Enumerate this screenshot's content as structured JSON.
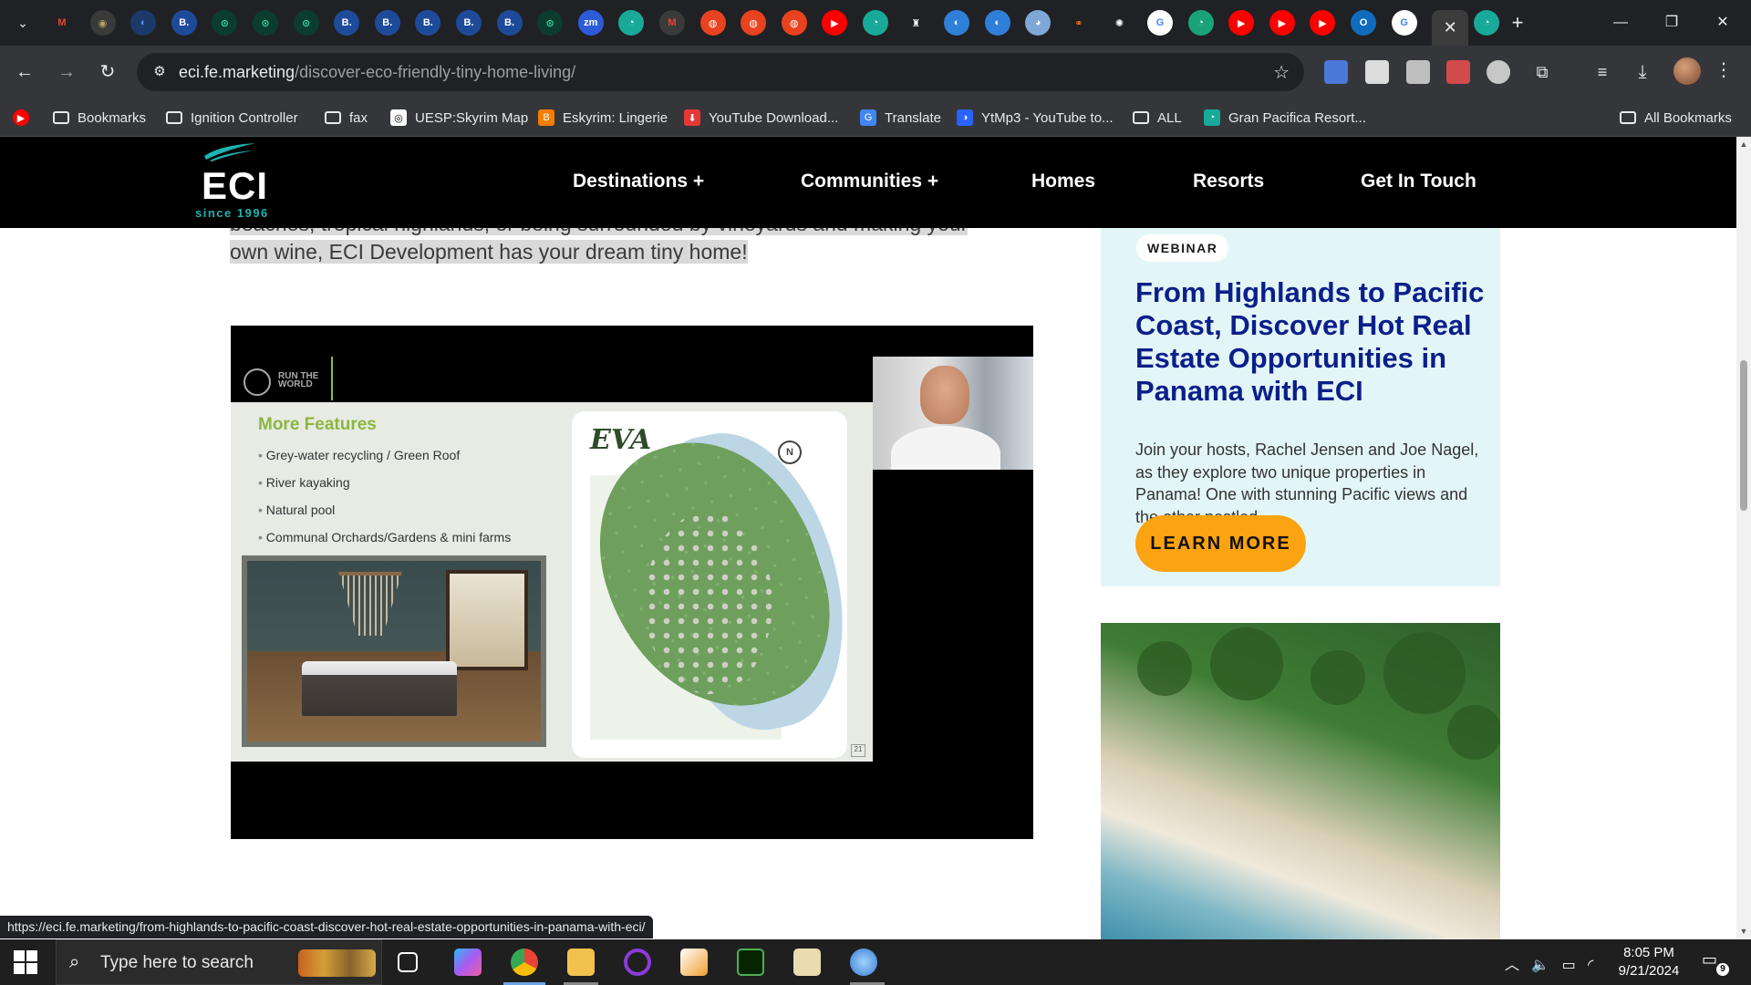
{
  "browser": {
    "tab_favicons": [
      {
        "name": "gmail-icon",
        "glyph": "M",
        "color": "#ea4335",
        "bg": "transparent"
      },
      {
        "name": "shield-seal-icon",
        "glyph": "◉",
        "color": "#b8a36a",
        "bg": "#3a3a3a"
      },
      {
        "name": "globe-tab-icon",
        "glyph": "◐",
        "color": "#4f9bff",
        "bg": "#1b3a6a"
      },
      {
        "name": "booking-icon",
        "glyph": "B.",
        "color": "#ffffff",
        "bg": "#1e4a9a"
      },
      {
        "name": "tripadvisor-icon",
        "glyph": "⊙",
        "color": "#34e0a1",
        "bg": "#0b3d2e"
      },
      {
        "name": "tripadvisor-icon",
        "glyph": "⊙",
        "color": "#34e0a1",
        "bg": "#0b3d2e"
      },
      {
        "name": "tripadvisor-icon",
        "glyph": "⊙",
        "color": "#34e0a1",
        "bg": "#0b3d2e"
      },
      {
        "name": "booking-icon",
        "glyph": "B.",
        "color": "#ffffff",
        "bg": "#1e4a9a"
      },
      {
        "name": "booking-icon",
        "glyph": "B.",
        "color": "#ffffff",
        "bg": "#1e4a9a"
      },
      {
        "name": "booking-icon",
        "glyph": "B.",
        "color": "#ffffff",
        "bg": "#1e4a9a"
      },
      {
        "name": "booking-icon",
        "glyph": "B.",
        "color": "#ffffff",
        "bg": "#1e4a9a"
      },
      {
        "name": "booking-icon",
        "glyph": "B.",
        "color": "#ffffff",
        "bg": "#1e4a9a"
      },
      {
        "name": "tripadvisor-icon",
        "glyph": "⊙",
        "color": "#34e0a1",
        "bg": "#0b3d2e"
      },
      {
        "name": "zoom-icon",
        "glyph": "zm",
        "color": "#ffffff",
        "bg": "#2d5bd8"
      },
      {
        "name": "teal-tab-icon",
        "glyph": "◔",
        "color": "#ffffff",
        "bg": "#18a999"
      },
      {
        "name": "gmail-icon",
        "glyph": "M",
        "color": "#ea4335",
        "bg": "#3a3a3a"
      },
      {
        "name": "red-app-icon",
        "glyph": "◍",
        "color": "#ffffff",
        "bg": "#e8421e"
      },
      {
        "name": "red-app-icon",
        "glyph": "◍",
        "color": "#ffffff",
        "bg": "#e8421e"
      },
      {
        "name": "red-app-icon",
        "glyph": "◍",
        "color": "#ffffff",
        "bg": "#e8421e"
      },
      {
        "name": "youtube-icon",
        "glyph": "▶",
        "color": "#ffffff",
        "bg": "#ff0000"
      },
      {
        "name": "teal-tab-icon",
        "glyph": "◔",
        "color": "#ffffff",
        "bg": "#18a999"
      },
      {
        "name": "castle-icon",
        "glyph": "♜",
        "color": "#ffffff",
        "bg": "#202124"
      },
      {
        "name": "globe-tab-icon",
        "glyph": "◐",
        "color": "#ffffff",
        "bg": "#2f7fd8"
      },
      {
        "name": "globe-tab-icon",
        "glyph": "◐",
        "color": "#ffffff",
        "bg": "#2f7fd8"
      },
      {
        "name": "chat-bubble-icon",
        "glyph": "◕",
        "color": "#ffffff",
        "bg": "#7fa8d8"
      },
      {
        "name": "link-icon",
        "glyph": "⚭",
        "color": "#ff7a1a",
        "bg": "transparent"
      },
      {
        "name": "openai-icon",
        "glyph": "✺",
        "color": "#ffffff",
        "bg": "#202124"
      },
      {
        "name": "google-icon",
        "glyph": "G",
        "color": "#4285f4",
        "bg": "#ffffff"
      },
      {
        "name": "green-chat-icon",
        "glyph": "◔",
        "color": "#ffffff",
        "bg": "#1aa37a"
      },
      {
        "name": "youtube-icon",
        "glyph": "▶",
        "color": "#ffffff",
        "bg": "#ff0000"
      },
      {
        "name": "youtube-icon",
        "glyph": "▶",
        "color": "#ffffff",
        "bg": "#ff0000"
      },
      {
        "name": "youtube-icon",
        "glyph": "▶",
        "color": "#ffffff",
        "bg": "#ff0000"
      },
      {
        "name": "outlook-icon",
        "glyph": "O",
        "color": "#ffffff",
        "bg": "#0f6cbd"
      },
      {
        "name": "google-icon",
        "glyph": "G",
        "color": "#4285f4",
        "bg": "#ffffff"
      }
    ],
    "last_tab_icon": {
      "name": "teal-tab-icon",
      "glyph": "◔",
      "color": "#ffffff",
      "bg": "#18a999"
    },
    "url_host": "eci.fe.marketing",
    "url_path": "/discover-eco-friendly-tiny-home-living/",
    "bookmarks": [
      {
        "label": "Bookmarks",
        "type": "folder"
      },
      {
        "label": "Ignition Controller",
        "type": "folder"
      },
      {
        "label": "fax",
        "type": "folder"
      },
      {
        "label": "UESP:Skyrim Map",
        "type": "site",
        "color": "#ffffff",
        "glyph": "◎"
      },
      {
        "label": "Eskyrim: Lingerie",
        "type": "site",
        "color": "#f57d00",
        "glyph": "B"
      },
      {
        "label": "YouTube Download...",
        "type": "site",
        "color": "#e53935",
        "glyph": "⬇"
      },
      {
        "label": "Translate",
        "type": "site",
        "color": "#4285f4",
        "glyph": "G"
      },
      {
        "label": "YtMp3 - YouTube to...",
        "type": "site",
        "color": "#2962ff",
        "glyph": "◑"
      },
      {
        "label": "ALL",
        "type": "folder"
      },
      {
        "label": "Gran Pacifica Resort...",
        "type": "site",
        "color": "#18a999",
        "glyph": "◔"
      }
    ],
    "all_bookmarks": "All Bookmarks",
    "status_url": "https://eci.fe.marketing/from-highlands-to-pacific-coast-discover-hot-real-estate-opportunities-in-panama-with-eci/"
  },
  "site": {
    "logo_text": "ECI",
    "logo_since": "since 1996",
    "brand_color": "#1fb3b0",
    "nav": [
      "Destinations +",
      "Communities +",
      "Homes",
      "Resorts",
      "Get In Touch"
    ],
    "intro_line1": "beaches, tropical highlands, or being surrounded by vineyards and making your",
    "intro_line2": "own wine, ECI Development has your dream tiny home!",
    "slide": {
      "brand": "RUN THE WORLD",
      "title": "More Features",
      "features": [
        "Grey-water recycling / Green Roof",
        "River kayaking",
        "Natural pool",
        "Communal Orchards/Gardens & mini farms"
      ],
      "map_logo": "EVA",
      "north": "N",
      "page_number": "21"
    },
    "card": {
      "badge": "WEBINAR",
      "title": "From Highlands to Pacific Coast, Discover Hot Real Estate Opportunities in Panama with ECI",
      "text": "Join your hosts, Rachel Jensen and Joe Nagel, as they explore two unique properties in Panama! One with stunning Pacific views and the other nestled ...",
      "button": "LEARN MORE",
      "title_color": "#0b1f8a",
      "button_color": "#fca311"
    }
  },
  "taskbar": {
    "search_placeholder": "Type here to search",
    "time": "8:05 PM",
    "date": "9/21/2024",
    "notification_count": "9"
  }
}
